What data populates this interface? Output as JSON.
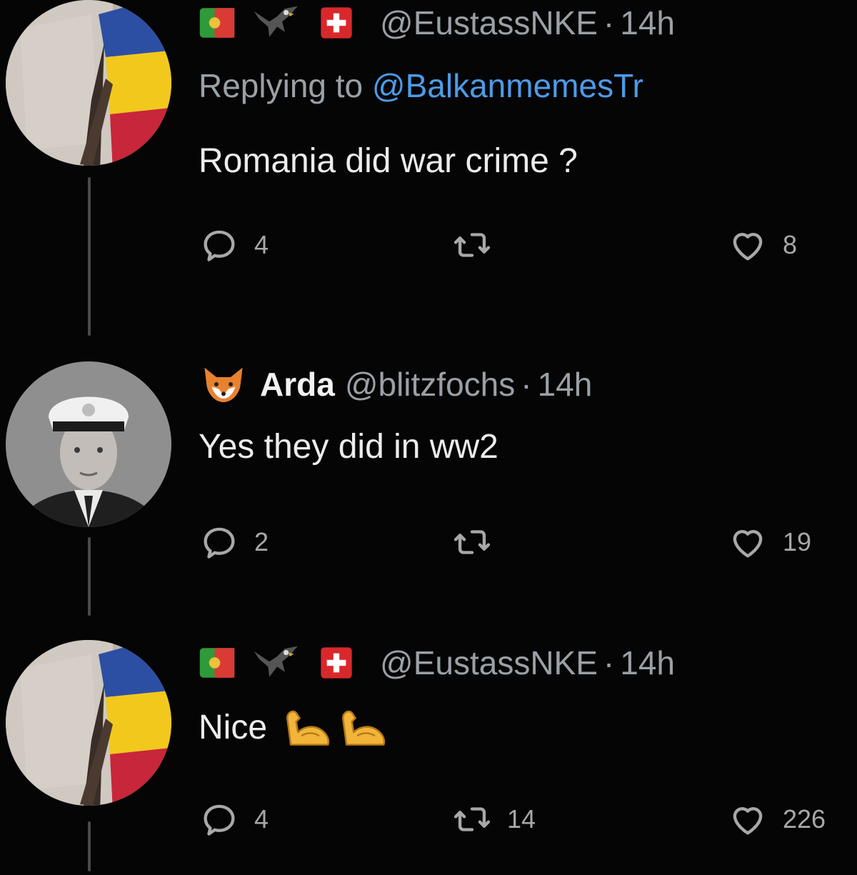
{
  "tweets": [
    {
      "handle": "@EustassNKE",
      "time": "14h",
      "replying_label": "Replying to",
      "replying_to": "@BalkanmemesTr",
      "text": "Romania did war crime ?",
      "replies": "4",
      "retweets": "",
      "likes": "8",
      "header_icons": [
        "portugal-flag-icon",
        "eagle-icon",
        "swiss-flag-icon"
      ]
    },
    {
      "name": "Arda",
      "handle": "@blitzfochs",
      "time": "14h",
      "text": "Yes they did in ww2",
      "replies": "2",
      "retweets": "",
      "likes": "19",
      "header_icons": [
        "fox-icon"
      ]
    },
    {
      "handle": "@EustassNKE",
      "time": "14h",
      "text": "Nice",
      "replies": "4",
      "retweets": "14",
      "likes": "226",
      "header_icons": [
        "portugal-flag-icon",
        "eagle-icon",
        "swiss-flag-icon"
      ],
      "text_icons": [
        "flexed-biceps-icon",
        "flexed-biceps-icon"
      ]
    }
  ],
  "colors": {
    "background": "#050505",
    "link": "#4d9be8",
    "muted": "#9aa0a6",
    "thread_line": "#4a4a4a"
  }
}
